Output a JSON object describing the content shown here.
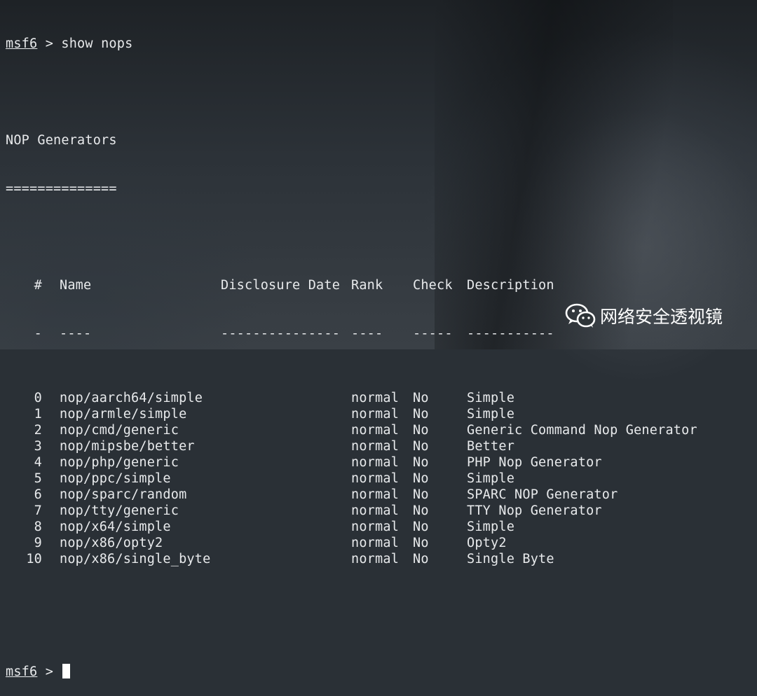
{
  "terminal": {
    "prompt_user": "msf6",
    "prompt_sep": " > ",
    "command": "show nops",
    "section_title": "NOP Generators",
    "section_underline": "==============",
    "headers": {
      "num": "#",
      "name": "Name",
      "date": "Disclosure Date",
      "rank": "Rank",
      "check": "Check",
      "desc": "Description"
    },
    "header_dashes": {
      "num": "-",
      "name": "----",
      "date": "---------------",
      "rank": "----",
      "check": "-----",
      "desc": "-----------"
    },
    "rows": [
      {
        "num": "0",
        "name": "nop/aarch64/simple",
        "date": "",
        "rank": "normal",
        "check": "No",
        "desc": "Simple"
      },
      {
        "num": "1",
        "name": "nop/armle/simple",
        "date": "",
        "rank": "normal",
        "check": "No",
        "desc": "Simple"
      },
      {
        "num": "2",
        "name": "nop/cmd/generic",
        "date": "",
        "rank": "normal",
        "check": "No",
        "desc": "Generic Command Nop Generator"
      },
      {
        "num": "3",
        "name": "nop/mipsbe/better",
        "date": "",
        "rank": "normal",
        "check": "No",
        "desc": "Better"
      },
      {
        "num": "4",
        "name": "nop/php/generic",
        "date": "",
        "rank": "normal",
        "check": "No",
        "desc": "PHP Nop Generator"
      },
      {
        "num": "5",
        "name": "nop/ppc/simple",
        "date": "",
        "rank": "normal",
        "check": "No",
        "desc": "Simple"
      },
      {
        "num": "6",
        "name": "nop/sparc/random",
        "date": "",
        "rank": "normal",
        "check": "No",
        "desc": "SPARC NOP Generator"
      },
      {
        "num": "7",
        "name": "nop/tty/generic",
        "date": "",
        "rank": "normal",
        "check": "No",
        "desc": "TTY Nop Generator"
      },
      {
        "num": "8",
        "name": "nop/x64/simple",
        "date": "",
        "rank": "normal",
        "check": "No",
        "desc": "Simple"
      },
      {
        "num": "9",
        "name": "nop/x86/opty2",
        "date": "",
        "rank": "normal",
        "check": "No",
        "desc": "Opty2"
      },
      {
        "num": "10",
        "name": "nop/x86/single_byte",
        "date": "",
        "rank": "normal",
        "check": "No",
        "desc": "Single Byte"
      }
    ],
    "final_prompt_user": "msf6",
    "final_prompt_sep": " > "
  },
  "watermark": {
    "icon": "wechat-icon",
    "text": "网络安全透视镜"
  },
  "colors": {
    "text": "#e8eaec",
    "cursor": "#ffffff"
  }
}
